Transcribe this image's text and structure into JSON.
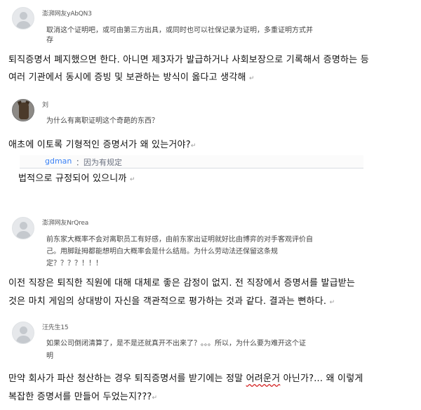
{
  "comments": [
    {
      "username": "澎湃网友yAbQN3",
      "lines": [
        "取消这个证明吧，或可由第三方出具，或同时也可以社保记录为证明，多重证明方式并",
        "存"
      ],
      "translation": [
        "퇴직증명서 폐지했으면 한다. 아니면 제3자가 발급하거나 사회보장으로 기록해서 증명하는 등",
        "여러 기관에서 동시에 증빙 및 보관하는 방식이 옳다고 생각해"
      ]
    },
    {
      "username": "刘",
      "lines": [
        "为什么有离职证明这个奇葩的东西？"
      ],
      "translation": [
        "애초에 이토록 기형적인 증명서가 왜 있는거야?"
      ]
    },
    {
      "quote_user": "gdman",
      "quote_text": "：因为有规定",
      "translation": [
        "법적으로 규정되어 있으니까"
      ]
    },
    {
      "username": "澎湃网友NrQrea",
      "lines": [
        "前东家大概率不会对离职员工有好感，由前东家出证明就好比由博弈的对手客观评价自",
        "己。用脚趾拇都能想明白大概率会是什么结局。为什么劳动法还保留这条规",
        "定？？？？！！！"
      ],
      "translation": [
        "이전 직장은 퇴직한 직원에 대해 대체로 좋은 감정이 없지. 전 직장에서 증명서를 발급받는",
        "것은 마치 게임의 상대방이 자신을 객관적으로 평가하는 것과 같다. 결과는 뻔하다."
      ]
    },
    {
      "username": "汪先生15",
      "lines": [
        "如果公司倒闭清算了，是不是还就真开不出来了？。。。所以，为什么要为难开这个证",
        "明"
      ],
      "translation_a": "만약 회사가 파산 청산하는 경우 퇴직증명서를 받기에는 정말 ",
      "translation_b": "어려운거",
      "translation_c": " 아닌가?... 왜 이렇게",
      "translation_2": "복잡한 증명서를 만들어 두었는지???"
    }
  ],
  "return_mark": "↵"
}
